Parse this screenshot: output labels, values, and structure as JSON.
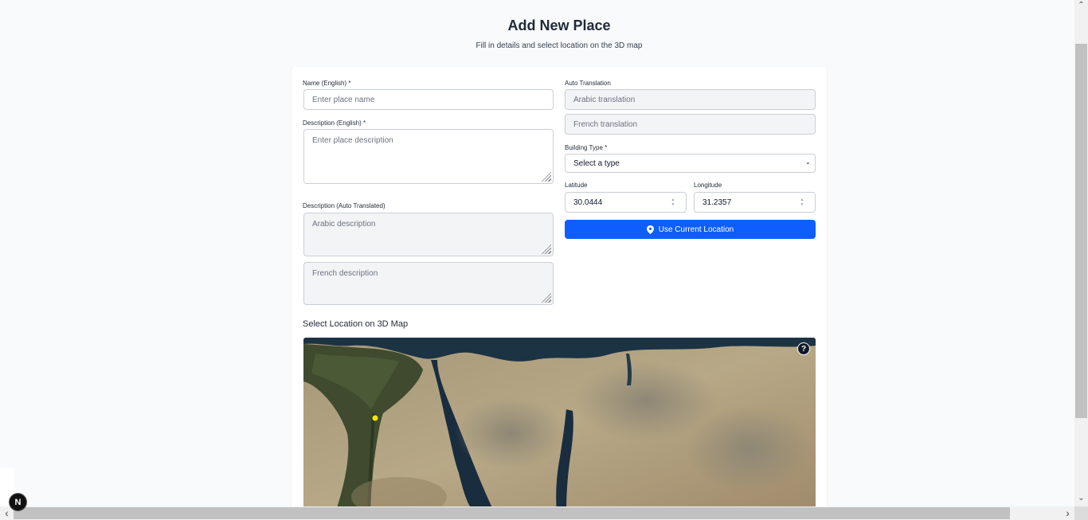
{
  "header": {
    "title": "Add New Place",
    "subtitle": "Fill in details and select location on the 3D map"
  },
  "form": {
    "name_label": "Name (English) *",
    "name_placeholder": "Enter place name",
    "description_label": "Description (English) *",
    "description_placeholder": "Enter place description",
    "auto_desc_label": "Description (Auto Translated)",
    "arabic_desc_placeholder": "Arabic description",
    "french_desc_placeholder": "French description",
    "auto_translation_label": "Auto Translation",
    "arabic_translation_placeholder": "Arabic translation",
    "french_translation_placeholder": "French translation",
    "building_type_label": "Building Type *",
    "building_type_selected": "Select a type",
    "latitude_label": "Latitude",
    "latitude_value": "30.0444",
    "longitude_label": "Longitude",
    "longitude_value": "31.2357",
    "use_location_label": "Use Current Location"
  },
  "map": {
    "title": "Select Location on 3D Map",
    "help_label": "?",
    "marker_color": "#ffe600"
  },
  "colors": {
    "accent": "#0d5efc",
    "background": "#f8fafc"
  },
  "dev": {
    "badge_label": "N"
  },
  "scrollbars": {
    "up_arrow": "⌃",
    "down_arrow": "⌄",
    "left_arrow": "‹",
    "right_arrow": "›"
  }
}
